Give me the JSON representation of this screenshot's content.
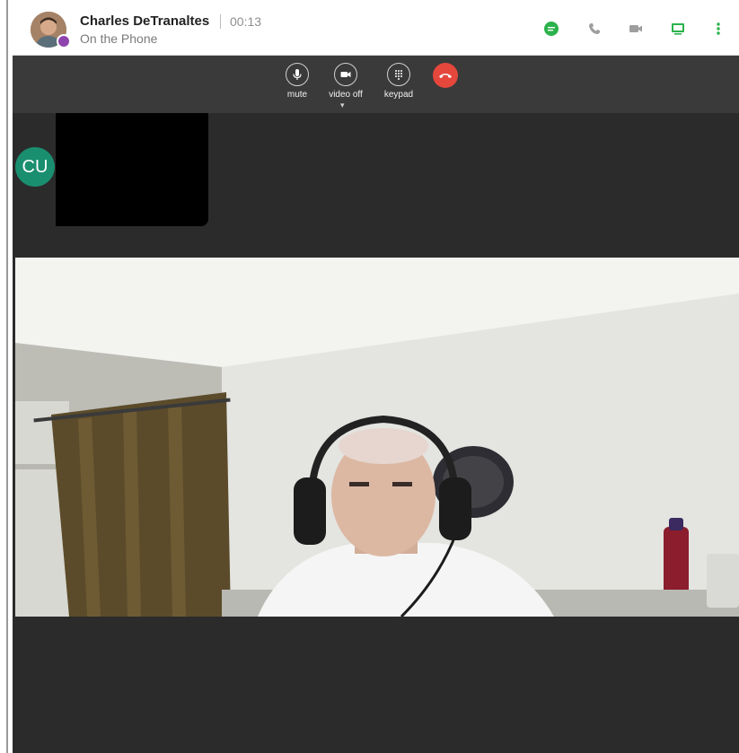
{
  "caller": {
    "name": "Charles DeTranaltes",
    "timer": "00:13",
    "status": "On the Phone"
  },
  "header_actions": [
    {
      "icon": "chat-icon",
      "color": "#2bb24c"
    },
    {
      "icon": "phone-icon",
      "color": "#9e9e9e"
    },
    {
      "icon": "video-icon",
      "color": "#9e9e9e"
    },
    {
      "icon": "screen-share-icon",
      "color": "#2bb24c"
    },
    {
      "icon": "more-vertical-icon",
      "color": "#2bb24c"
    }
  ],
  "controls": {
    "mute": "mute",
    "video": "video off",
    "keypad": "keypad"
  },
  "participant": {
    "initials": "CU"
  },
  "colors": {
    "accent": "#2bb24c",
    "hangup": "#e5473c",
    "avatar_initials": "#1a8f6f",
    "presence": "#8e44ad"
  }
}
